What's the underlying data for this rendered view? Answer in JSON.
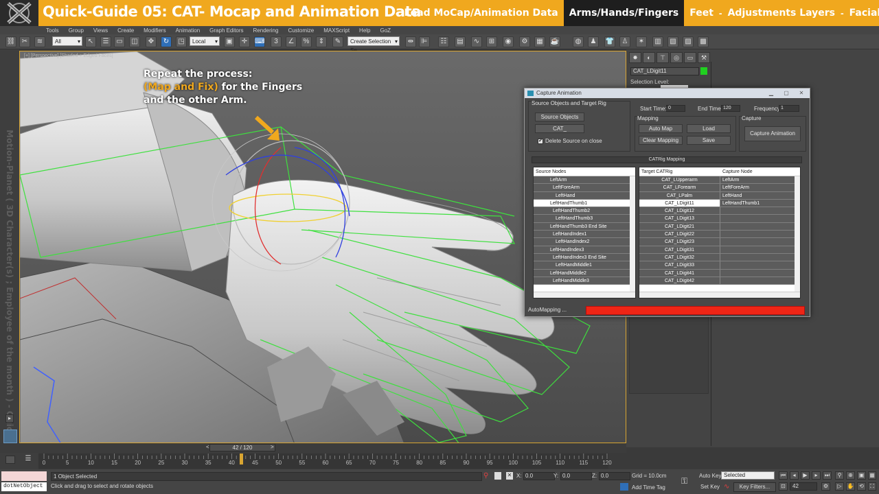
{
  "banner": {
    "title": "Quick-Guide 05:  CAT- Mocap and Animation Data",
    "nav": [
      {
        "label": "Load MoCap/Animation Data",
        "active": false
      },
      {
        "label": "Arms/Hands/Fingers",
        "active": true
      },
      {
        "label": "Feet",
        "active": false
      },
      {
        "label": "Adjustments Layers",
        "active": false
      },
      {
        "label": "Facial Anim",
        "active": false
      }
    ],
    "separator": "-",
    "accent_color": "#f0a81e"
  },
  "menu": [
    "Tools",
    "Group",
    "Views",
    "Create",
    "Modifiers",
    "Animation",
    "Graph Editors",
    "Rendering",
    "Customize",
    "MAXScript",
    "Help",
    "GoZ"
  ],
  "toolbar": {
    "filter_value": "All",
    "reference_coord": "Local",
    "selection_set_placeholder": "Create Selection Se",
    "snap_label": "3"
  },
  "side_text": "Motion-Planet ( 3D Character(s) ; Employee of the month ) - Quick Guide",
  "viewport": {
    "label": "[+] [Perspective] [Shaded + Edged Faces]",
    "instruction_line1": "Repeat the process:",
    "instruction_hl": "(Map and Fix)",
    "instruction_line2_rest": " for the Fingers",
    "instruction_line3": "and the other Arm."
  },
  "command_panel": {
    "object_name": "CAT_LDigit11",
    "object_color": "#20d020",
    "selection_level": "Selection Level:"
  },
  "dialog": {
    "title": "Capture Animation",
    "source_group": "Source Objects and Target Rig",
    "source_objects_btn": "Source Objects",
    "cat_btn": "CAT_",
    "delete_source_label": "Delete Source on close",
    "delete_source_checked": true,
    "start_time_label": "Start Time:",
    "start_time": "0",
    "end_time_label": "End Time:",
    "end_time": "120",
    "frequency_label": "Frequency:",
    "frequency": "1",
    "mapping_group": "Mapping",
    "auto_map": "Auto Map",
    "load": "Load",
    "clear_mapping": "Clear Mapping",
    "save": "Save",
    "capture_group": "Capture",
    "capture_animation": "Capture Animation",
    "catrig_mapping": "CATRig Mapping",
    "source_nodes_header": "Source Nodes",
    "target_header": "Target CATRig",
    "capture_node_header": "Capture Node",
    "source_nodes": [
      "LeftArm",
      "LeftForeArm",
      "LeftHand",
      "LeftHandThumb1",
      "LeftHandThumb2",
      "LeftHandThumb3",
      "LeftHandThumb3 End Site",
      "LeftHandIndex1",
      "LeftHandIndex2",
      "LeftHandIndex3",
      "LeftHandIndex3 End Site",
      "LeftHandMiddle1",
      "LeftHandMiddle2",
      "LeftHandMiddle3"
    ],
    "target_rows": [
      {
        "target": "CAT_LUpperarm",
        "capture": "LeftArm"
      },
      {
        "target": "CAT_LForearm",
        "capture": "LeftForeArm"
      },
      {
        "target": "CAT_LPalm",
        "capture": "LeftHand"
      },
      {
        "target": "CAT_LDigit11",
        "capture": "LeftHandThumb1"
      },
      {
        "target": "CAT_LDigit12",
        "capture": ""
      },
      {
        "target": "CAT_LDigit13",
        "capture": ""
      },
      {
        "target": "CAT_LDigit21",
        "capture": ""
      },
      {
        "target": "CAT_LDigit22",
        "capture": ""
      },
      {
        "target": "CAT_LDigit23",
        "capture": ""
      },
      {
        "target": "CAT_LDigit31",
        "capture": ""
      },
      {
        "target": "CAT_LDigit32",
        "capture": ""
      },
      {
        "target": "CAT_LDigit33",
        "capture": ""
      },
      {
        "target": "CAT_LDigit41",
        "capture": ""
      },
      {
        "target": "CAT_LDigit42",
        "capture": ""
      }
    ],
    "selected_source_index": 3,
    "selected_target_index": 3,
    "progress_label": "AutoMapping ...",
    "progress_color": "#ee2516",
    "progress_fraction": 1.0
  },
  "timeline": {
    "frame_display": "42 / 120",
    "current_frame": 42,
    "ticks": [
      "0",
      "5",
      "10",
      "15",
      "20",
      "25",
      "30",
      "35",
      "40",
      "45",
      "50",
      "55",
      "60",
      "65",
      "70",
      "75",
      "80",
      "85",
      "90",
      "95",
      "100",
      "105",
      "110",
      "115",
      "120"
    ]
  },
  "status": {
    "listener_value": "",
    "dotnet": "dotNetObject",
    "selection": "1 Object Selected",
    "prompt": "Click and drag to select and rotate objects",
    "x_label": "X:",
    "x_value": "0.0",
    "y_label": "Y:",
    "y_value": "0.0",
    "z_label": "Z:",
    "z_value": "0.0",
    "grid": "Grid = 10.0cm",
    "add_time_tag": "Add Time Tag",
    "auto_key": "Auto Key",
    "set_key": "Set Key",
    "selected_dropdown": "Selected",
    "key_filters": "Key Filters...",
    "frame_field": "42"
  }
}
